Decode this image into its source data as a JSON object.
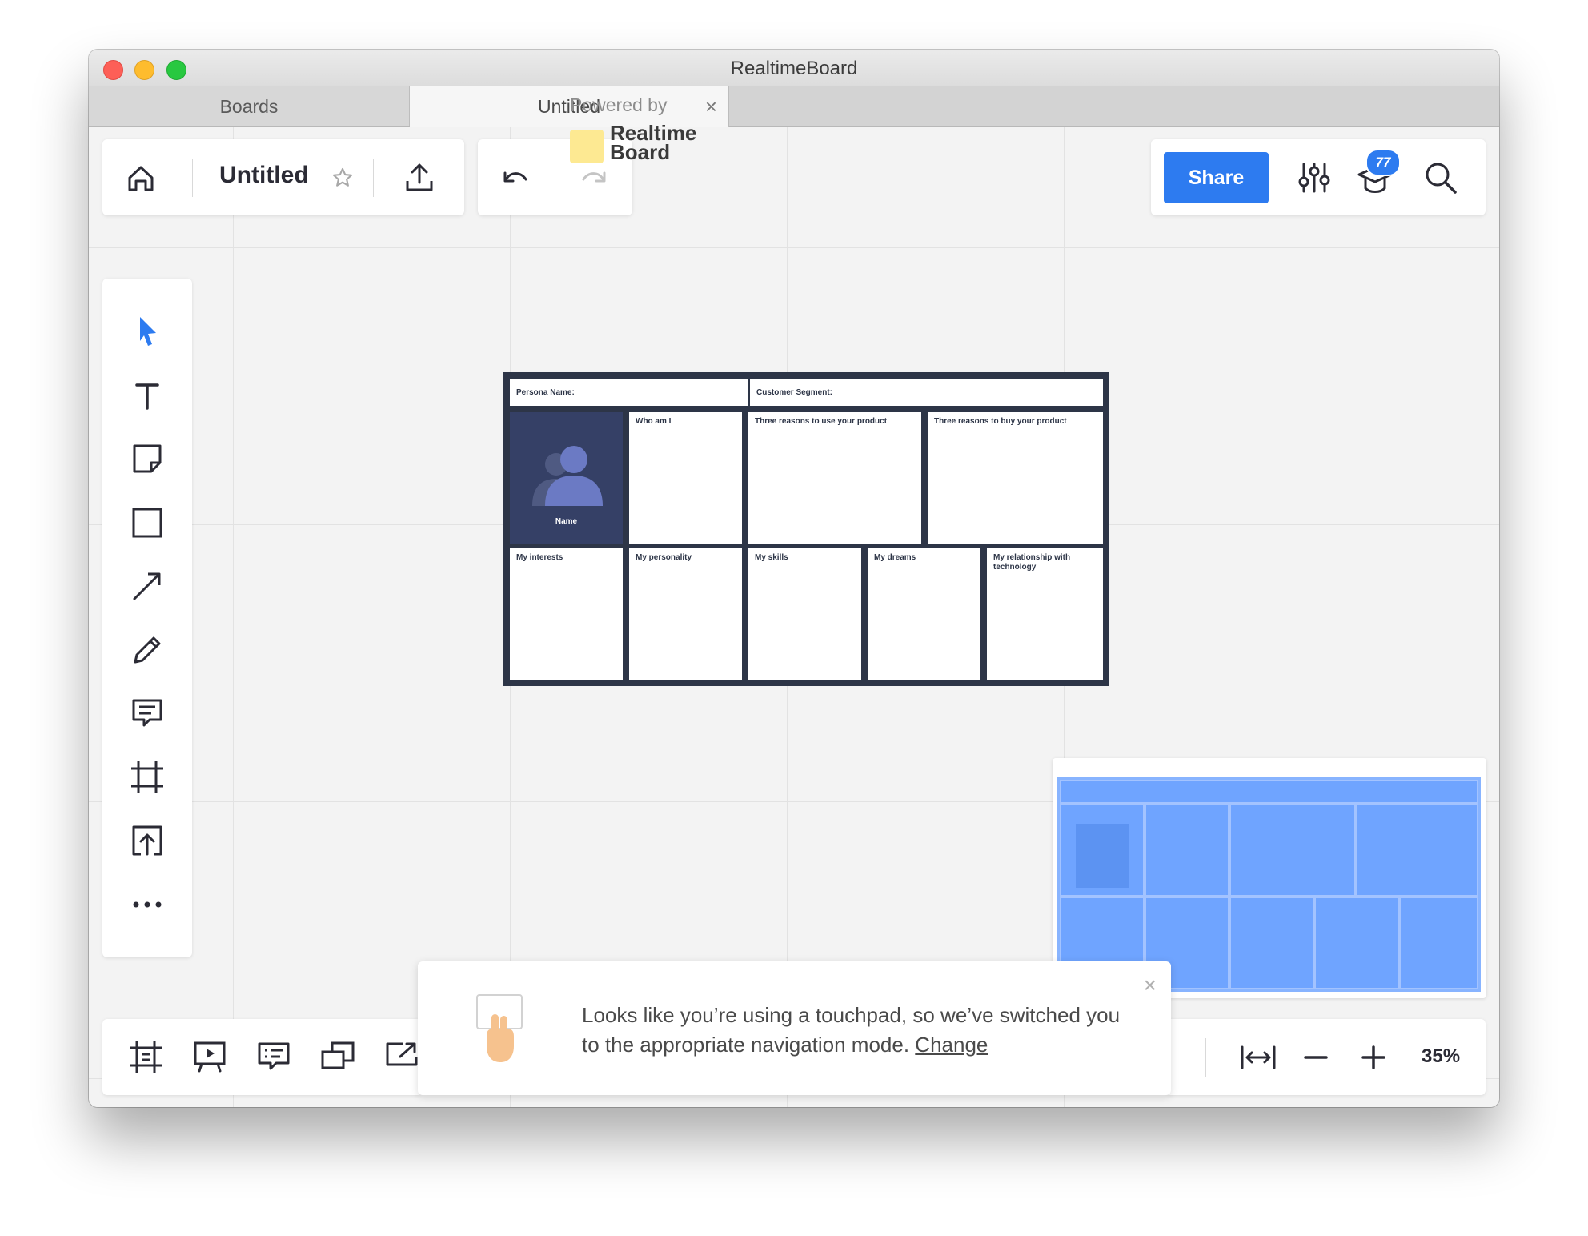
{
  "window": {
    "title": "RealtimeBoard"
  },
  "tabs": [
    {
      "label": "Boards"
    },
    {
      "label": "Untitled",
      "close": "×"
    }
  ],
  "toolbar": {
    "board_name": "Untitled",
    "powered_by": "Powered by",
    "brand": "Realtime Board",
    "share_label": "Share",
    "notifications_count": "77"
  },
  "template": {
    "persona_name": "Persona Name:",
    "customer_segment": "Customer Segment:",
    "photo_name": "Name",
    "who_am_i": "Who am I",
    "reasons_use": "Three reasons to use your product",
    "reasons_buy": "Three reasons to buy your product",
    "interests": "My interests",
    "personality": "My personality",
    "skills": "My skills",
    "dreams": "My dreams",
    "technology": "My relationship with technology"
  },
  "toast": {
    "message": "Looks like you’re using a touchpad, so we’ve switched you to the appropriate navigation mode.",
    "link": "Change",
    "close": "×"
  },
  "zoom": {
    "level": "35%"
  },
  "colors": {
    "accent": "#2d7bf0",
    "template_dark": "#2d3547",
    "minimap_fill": "#6fa4ff",
    "sticky_yellow": "#fde992"
  },
  "icons": {
    "left_tools": [
      "select-arrow-icon",
      "text-icon",
      "sticky-note-icon",
      "rectangle-icon",
      "arrow-line-icon",
      "pen-icon",
      "comment-icon",
      "frame-icon",
      "upload-icon",
      "more-icon"
    ],
    "bottom_tools": [
      "frames-icon",
      "presentation-icon",
      "comments-icon",
      "screen-share-icon",
      "export-icon"
    ]
  }
}
